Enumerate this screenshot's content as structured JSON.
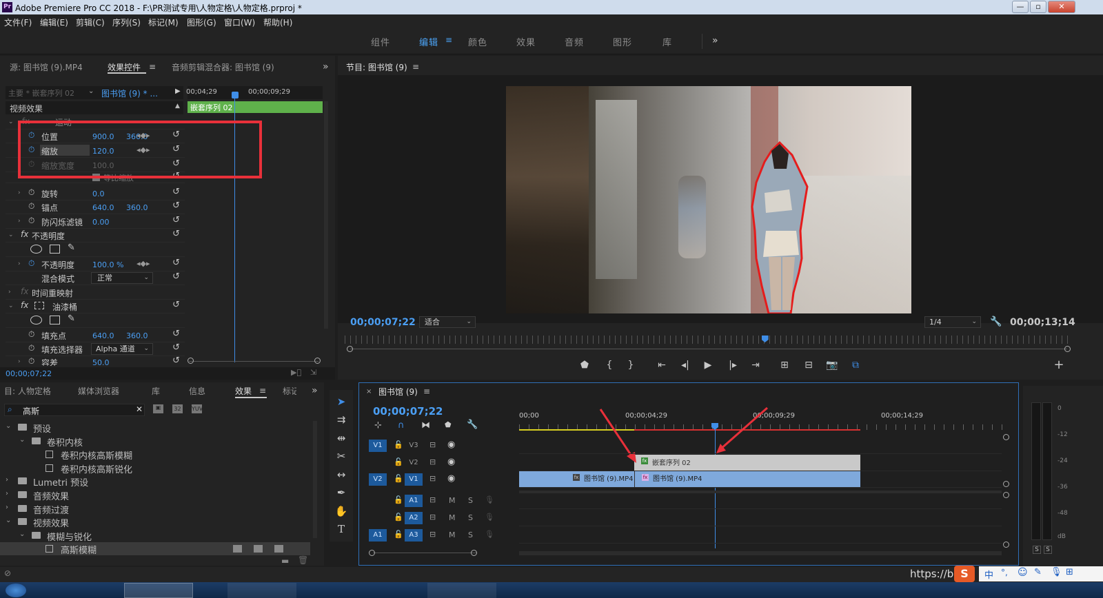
{
  "window": {
    "app_badge": "Pr",
    "title": "Adobe Premiere Pro CC 2018 - F:\\PR测试专用\\人物定格\\人物定格.prproj *",
    "min": "—",
    "max": "▫",
    "close": "✕"
  },
  "menu": [
    "文件(F)",
    "编辑(E)",
    "剪辑(C)",
    "序列(S)",
    "标记(M)",
    "图形(G)",
    "窗口(W)",
    "帮助(H)"
  ],
  "workspaces": {
    "items": [
      "组件",
      "编辑",
      "颜色",
      "效果",
      "音频",
      "图形",
      "库"
    ],
    "active": "编辑",
    "more": "»"
  },
  "effect_panel": {
    "tabs": [
      "源: 图书馆 (9).MP4",
      "效果控件",
      "音频剪辑混合器: 图书馆 (9)"
    ],
    "active_tab": "效果控件",
    "expand": "»",
    "master": "主要 * 嵌套序列 02",
    "clip": "图书馆 (9) * ...",
    "ruler": [
      "00;04;29",
      "00;00;09;29"
    ],
    "nested_clip": "嵌套序列 02",
    "video_effects": "视频效果",
    "motion": "运动",
    "position": {
      "label": "位置",
      "x": "900.0",
      "y": "360.0"
    },
    "scale": {
      "label": "缩放",
      "value": "120.0"
    },
    "scale_width": {
      "label": "缩放宽度",
      "value": "100.0"
    },
    "uniform_scale": "等比缩放",
    "rotation": {
      "label": "旋转",
      "value": "0.0"
    },
    "anchor": {
      "label": "锚点",
      "x": "640.0",
      "y": "360.0"
    },
    "flicker": {
      "label": "防闪烁滤镜",
      "value": "0.00"
    },
    "opacity_section": "不透明度",
    "opacity": {
      "label": "不透明度",
      "value": "100.0 %"
    },
    "blend": {
      "label": "混合模式",
      "value": "正常"
    },
    "time_remap": "时间重映射",
    "bucket": "油漆桶",
    "fill_point": {
      "label": "填充点",
      "x": "640.0",
      "y": "360.0"
    },
    "fill_selector": {
      "label": "填充选择器",
      "value": "Alpha 通道"
    },
    "tolerance": {
      "label": "容差",
      "value": "50.0"
    },
    "timecode": "00;00;07;22"
  },
  "program": {
    "title": "节目: 图书馆 (9)",
    "timecode": "00;00;07;22",
    "fit": "适合",
    "resolution": "1/4",
    "duration": "00;00;13;14",
    "playhead_fraction": 0.57
  },
  "effects_panel": {
    "tabs": [
      "目: 人物定格",
      "媒体浏览器",
      "库",
      "信息",
      "效果",
      "标记"
    ],
    "active_tab": "效果",
    "more": "»",
    "search": "高斯",
    "tree": [
      {
        "label": "预设",
        "level": 0,
        "type": "folder",
        "open": true
      },
      {
        "label": "卷积内核",
        "level": 1,
        "type": "folder",
        "open": true
      },
      {
        "label": "卷积内核高斯模糊",
        "level": 2,
        "type": "preset"
      },
      {
        "label": "卷积内核高斯锐化",
        "level": 2,
        "type": "preset"
      },
      {
        "label": "Lumetri 预设",
        "level": 0,
        "type": "folder",
        "open": false
      },
      {
        "label": "音频效果",
        "level": 0,
        "type": "folder",
        "open": false
      },
      {
        "label": "音频过渡",
        "level": 0,
        "type": "folder",
        "open": false
      },
      {
        "label": "视频效果",
        "level": 0,
        "type": "folder",
        "open": true
      },
      {
        "label": "模糊与锐化",
        "level": 1,
        "type": "folder",
        "open": true
      },
      {
        "label": "高斯模糊",
        "level": 2,
        "type": "effect",
        "selected": true
      }
    ]
  },
  "timeline": {
    "title": "图书馆 (9)",
    "timecode": "00;00;07;22",
    "ruler": [
      "00;00",
      "00;00;04;29",
      "00;00;09;29",
      "00;00;14;29"
    ],
    "video_tracks": [
      {
        "src": "V1",
        "name": "V3"
      },
      {
        "src": "",
        "name": "V2"
      },
      {
        "src": "V2",
        "name": "V1"
      }
    ],
    "audio_tracks": [
      {
        "src": "",
        "name": "A1"
      },
      {
        "src": "",
        "name": "A2"
      },
      {
        "src": "A1",
        "name": "A3"
      }
    ],
    "m": "M",
    "s": "S",
    "clips": {
      "nested": "嵌套序列 02",
      "v1a": "图书馆 (9).MP4",
      "v1b": "图书馆 (9).MP4"
    }
  },
  "audio_meter": {
    "labels": [
      "0",
      "-12",
      "-24",
      "-36",
      "-48",
      "dB"
    ],
    "solo": [
      "S",
      "S"
    ]
  },
  "watermark": "https://bl"
}
